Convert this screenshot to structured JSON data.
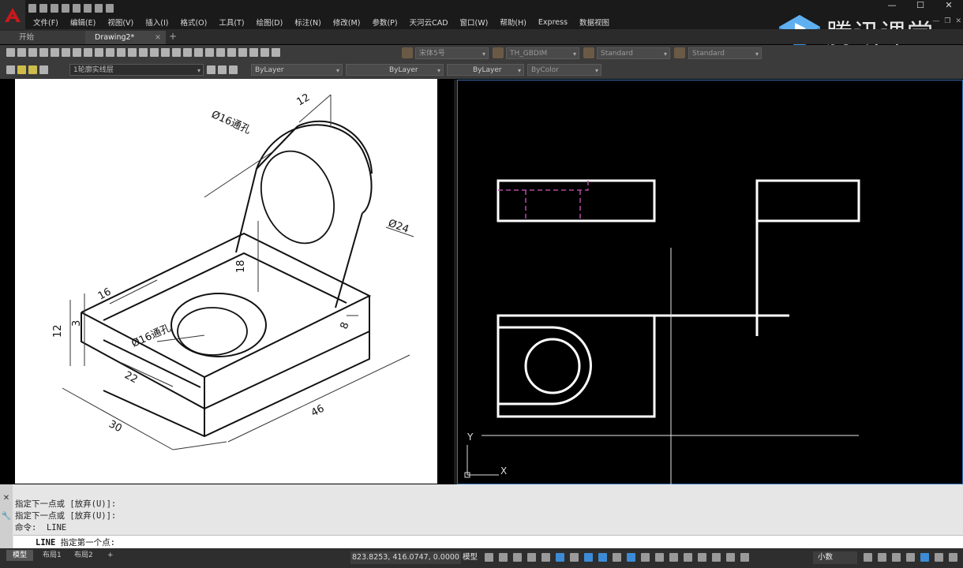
{
  "menubar": {
    "items": [
      "文件(F)",
      "编辑(E)",
      "视图(V)",
      "插入(I)",
      "格式(O)",
      "工具(T)",
      "绘图(D)",
      "标注(N)",
      "修改(M)",
      "参数(P)",
      "天河云CAD",
      "窗口(W)",
      "帮助(H)",
      "Express",
      "数据视图"
    ]
  },
  "brand": {
    "text": "腾讯课堂",
    "color": "#3d8bd6"
  },
  "tabs": {
    "start": "开始",
    "drawing": "Drawing2*",
    "close": "×",
    "add": "+"
  },
  "toolbar": {
    "text_style": "宋体5号",
    "dim_style": "TH_GBDIM",
    "table_style": "Standard",
    "mleader_style": "Standard",
    "layer": "1轮廓实线层",
    "color": "ByLayer",
    "linetype": "ByLayer",
    "lineweight": "ByLayer",
    "plotstyle": "ByColor"
  },
  "reference_drawing": {
    "labels": {
      "hole_top": "Ø16通孔",
      "dia24": "Ø24",
      "dim12_top": "12",
      "dim18": "18",
      "dim16": "16",
      "dim3": "3",
      "dim12_left": "12",
      "hole_base": "Ø16通孔",
      "dim8": "8",
      "dim22": "22",
      "dim30": "30",
      "dim46": "46"
    }
  },
  "viewport": {
    "ucs_x": "X",
    "ucs_y": "Y"
  },
  "command": {
    "history": [
      "指定下一点或 [放弃(U)]:",
      "指定下一点或 [放弃(U)]:",
      "命令:  LINE"
    ],
    "prompt_cmd": "LINE",
    "prompt_text": " 指定第一个点:",
    "side_close": "✕",
    "side_tool": "🔧"
  },
  "status": {
    "layouts": [
      "模型",
      "布局1",
      "布局2"
    ],
    "add_layout": "+",
    "coords": "823.8253, 416.0747, 0.0000",
    "model_label": "模型",
    "units": "小数"
  }
}
